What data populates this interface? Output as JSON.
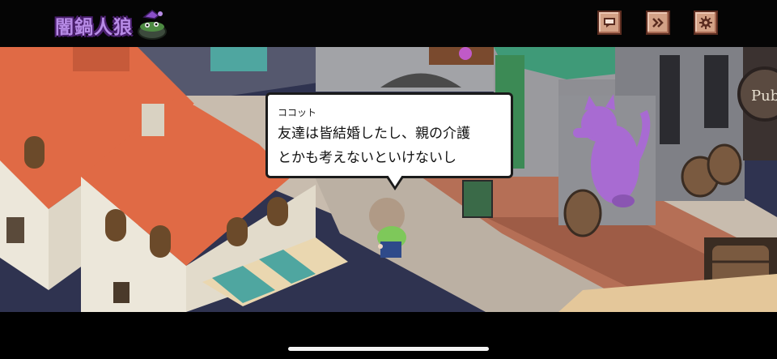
{
  "header": {
    "logo_text": "闇鍋人狼",
    "buttons": [
      {
        "name": "message-log-button",
        "icon": "speech-bubble-icon"
      },
      {
        "name": "skip-button",
        "icon": "fast-forward-icon"
      },
      {
        "name": "settings-button",
        "icon": "gear-icon"
      }
    ]
  },
  "dialogue": {
    "speaker": "ココット",
    "lines": [
      "友達は皆結婚したし、親の介護",
      "とかも考えないといけないし"
    ]
  },
  "scene": {
    "shop_sign_text": "Pub",
    "colors": {
      "roof": "#e06a45",
      "wall": "#ece7da",
      "street": "#b59a86",
      "dock": "#b56f56",
      "cat": "#a86bd2"
    }
  }
}
